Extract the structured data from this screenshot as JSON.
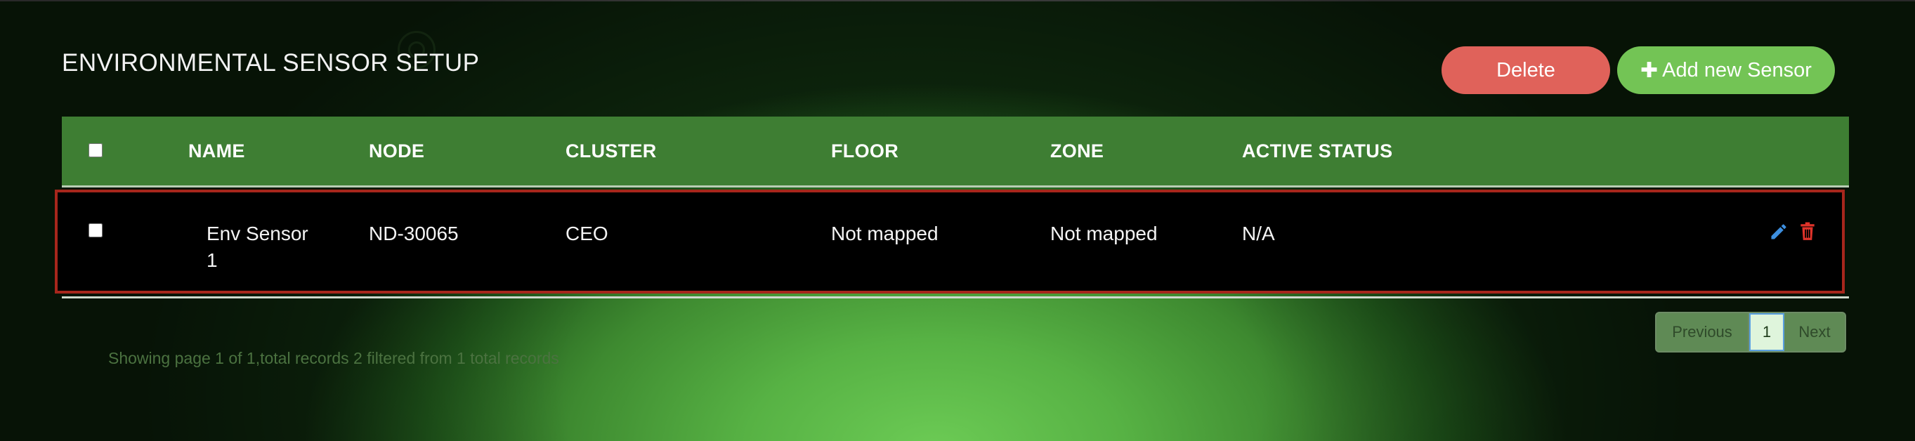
{
  "page": {
    "title": "ENVIRONMENTAL SENSOR SETUP"
  },
  "toolbar": {
    "delete_label": "Delete",
    "add_label": "Add new Sensor"
  },
  "table": {
    "columns": [
      "NAME",
      "NODE",
      "CLUSTER",
      "FLOOR",
      "ZONE",
      "ACTIVE STATUS"
    ],
    "rows": [
      {
        "name_line1": "Env Sensor",
        "name_line2": "1",
        "node": "ND-30065",
        "cluster": "CEO",
        "floor": "Not mapped",
        "zone": "Not mapped",
        "active_status": "N/A",
        "actions": [
          "edit-icon",
          "trash-icon"
        ]
      }
    ]
  },
  "pagination": {
    "previous_label": "Previous",
    "current_page": "1",
    "next_label": "Next"
  },
  "footer": {
    "info": "Showing page 1 of 1,total records 2 filtered from 1 total records"
  },
  "colors": {
    "header_bg": "#3e7e33",
    "delete_button": "#e0625a",
    "add_button": "#73c455",
    "selected_row_border": "#a7261c",
    "edit_icon": "#3d8fe0",
    "delete_icon": "#e0332a"
  }
}
